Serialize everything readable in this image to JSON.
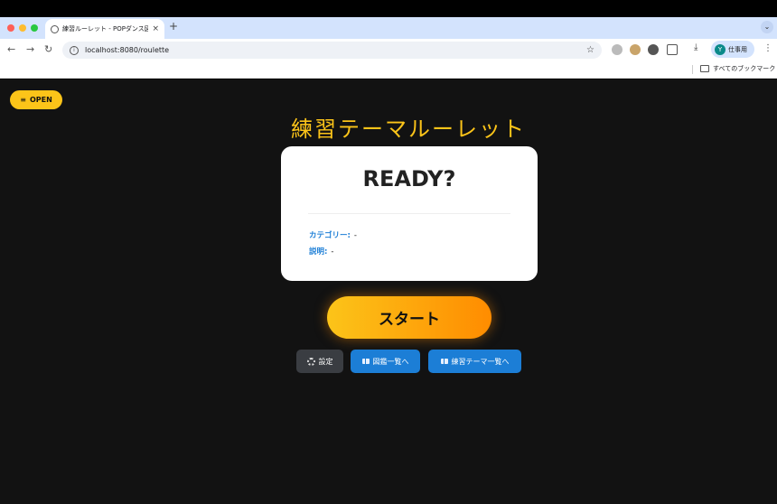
{
  "browser": {
    "tab_title": "練習ルーレット - POPダンス図鑑",
    "tab_close": "×",
    "new_tab": "+",
    "tab_menu": "⌄",
    "back": "←",
    "forward": "→",
    "reload": "↻",
    "site_info": "i",
    "url": "localhost:8080/roulette",
    "bookmark_star": "☆",
    "download": "⤓",
    "profile_initial": "Y",
    "profile_label": "仕事用",
    "menu": "⋮",
    "bookmarks_all": "すべてのブックマーク",
    "colors": {
      "tabstrip": "#d3e3fd",
      "red": "#ff5f57",
      "yellow": "#febc2e",
      "green": "#28c840"
    }
  },
  "page": {
    "open_glyph": "≡",
    "open_label": "OPEN",
    "title": "練習テーマルーレット",
    "card": {
      "heading": "READY?",
      "category_label": "カテゴリー:",
      "category_value": "-",
      "description_label": "説明:",
      "description_value": "-"
    },
    "start_label": "スタート",
    "settings_label": "設定",
    "zukan_label": "図鑑一覧へ",
    "theme_list_label": "練習テーマ一覧へ",
    "colors": {
      "accent": "#fcc419",
      "primary": "#1c7ed6",
      "background": "#121212"
    }
  }
}
